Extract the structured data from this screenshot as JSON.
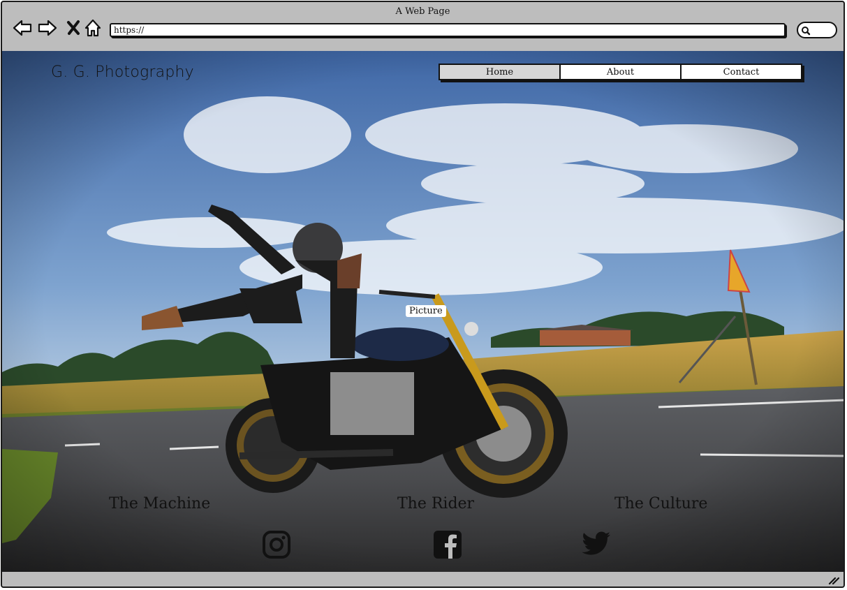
{
  "browser": {
    "title": "A Web Page",
    "address": "https://"
  },
  "site": {
    "title": "G. G. Photography",
    "nav": [
      {
        "label": "Home",
        "active": true
      },
      {
        "label": "About",
        "active": false
      },
      {
        "label": "Contact",
        "active": false
      }
    ],
    "hero_label": "Picture",
    "sections": [
      {
        "label": "The Machine"
      },
      {
        "label": "The Rider"
      },
      {
        "label": "The Culture"
      }
    ],
    "social_icons": [
      "instagram-icon",
      "facebook-icon",
      "twitter-icon"
    ]
  },
  "colors": {
    "chrome": "#bdbdbd",
    "active_tab": "#d6d6d6",
    "ink": "#111111"
  }
}
